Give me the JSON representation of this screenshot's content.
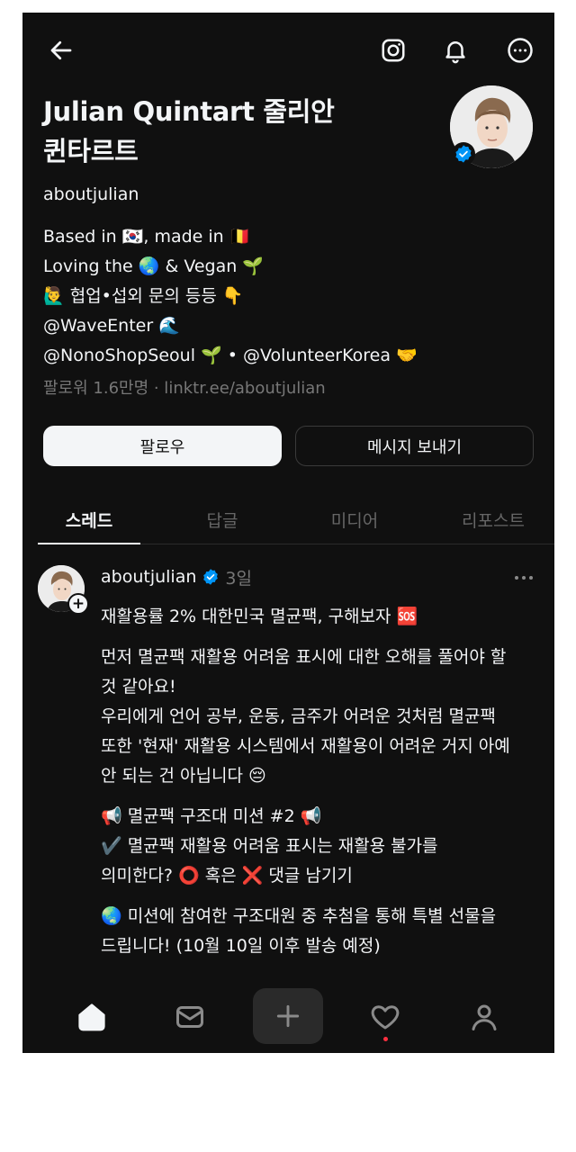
{
  "profile": {
    "name": "Julian Quintart 줄리안 퀸타르트",
    "handle": "aboutjulian",
    "bio": [
      "Based in 🇰🇷, made in 🇧🇪",
      "Loving the 🌏 & Vegan 🌱",
      "🙋‍♂️ 협업•섭외 문의 등등 👇",
      "@WaveEnter 🌊",
      "@NonoShopSeoul 🌱 • @VolunteerKorea 🤝"
    ],
    "followers_text": "팔로워 1.6만명 · linktr.ee/aboutjulian",
    "verified": true
  },
  "actions": {
    "follow_label": "팔로우",
    "message_label": "메시지 보내기"
  },
  "tabs": [
    {
      "label": "스레드",
      "active": true
    },
    {
      "label": "답글",
      "active": false
    },
    {
      "label": "미디어",
      "active": false
    },
    {
      "label": "리포스트",
      "active": false
    }
  ],
  "post": {
    "username": "aboutjulian",
    "time": "3일",
    "paragraphs": [
      [
        "재활용률 2% 대한민국 멸균팩, 구해보자 🆘"
      ],
      [
        "먼저 멸균팩 재활용 어려움 표시에 대한 오해를 풀어야 할",
        "것 같아요!",
        "우리에게 언어 공부, 운동, 금주가 어려운 것처럼 멸균팩",
        "또한 '현재' 재활용 시스템에서 재활용이 어려운 거지 아예",
        "안 되는 건 아닙니다 😔"
      ],
      [
        "📢 멸균팩 구조대 미션 #2 📢",
        "✔️ 멸균팩 재활용 어려움 표시는 재활용 불가를",
        "의미한다? ⭕ 혹은 ❌ 댓글 남기기"
      ],
      [
        "🌏 미션에 참여한 구조대원 중 추첨을 통해 특별 선물을",
        "드립니다! (10월 10일 이후 발송 예정)"
      ]
    ]
  },
  "nav": [
    "home-icon",
    "inbox-icon",
    "create-icon",
    "activity-icon",
    "profile-icon"
  ],
  "colors": {
    "background": "#101010",
    "text": "#f3f5f7",
    "muted": "#777777",
    "verified": "#0095f6",
    "notification": "#ff3040"
  }
}
